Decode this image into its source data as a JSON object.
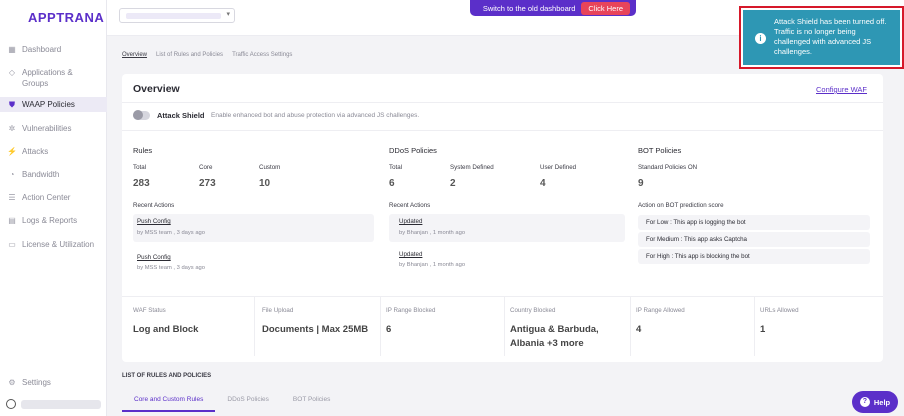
{
  "brand": {
    "logo": "APPTRANA",
    "accent": "#5b2fc9"
  },
  "sidebar": {
    "items": [
      {
        "label": "Dashboard",
        "icon": "grid-icon"
      },
      {
        "label": "Applications & Groups",
        "icon": "diamond-icon"
      },
      {
        "label": "WAAP Policies",
        "icon": "shield-icon",
        "active": true
      },
      {
        "label": "Vulnerabilities",
        "icon": "bug-icon"
      },
      {
        "label": "Attacks",
        "icon": "bolt-icon"
      },
      {
        "label": "Bandwidth",
        "icon": "gauge-icon"
      },
      {
        "label": "Action Center",
        "icon": "list-icon"
      },
      {
        "label": "Logs & Reports",
        "icon": "document-icon"
      },
      {
        "label": "License & Utilization",
        "icon": "card-icon"
      }
    ],
    "settings_label": "Settings"
  },
  "topbar": {
    "switch_text": "Switch to the old dashboard",
    "click_here": "Click Here"
  },
  "toast": {
    "message": "Attack Shield has been turned off. Traffic is no longer being challenged with advanced JS challenges.",
    "icon": "info-icon",
    "color": "#2e97b4",
    "border_color": "#d6182a"
  },
  "subtabs": [
    "Overview",
    "List of Rules and Policies",
    "Traffic Access Settings"
  ],
  "overview": {
    "title": "Overview",
    "configure_label": "Configure WAF",
    "attack_shield_label": "Attack Shield",
    "attack_shield_desc": "Enable enhanced bot and abuse protection via advanced JS challenges.",
    "attack_shield_enabled": false
  },
  "rules": {
    "title": "Rules",
    "total_label": "Total",
    "total": "283",
    "core_label": "Core",
    "core": "273",
    "custom_label": "Custom",
    "custom": "10",
    "recent_label": "Recent Actions",
    "actions": [
      {
        "title": "Push Config",
        "meta": "by MSS team , 3 days ago"
      },
      {
        "title": "Push Config",
        "meta": "by MSS team , 3 days ago"
      }
    ]
  },
  "ddos": {
    "title": "DDoS Policies",
    "total_label": "Total",
    "total": "6",
    "system_label": "System Defined",
    "system": "2",
    "user_label": "User Defined",
    "user": "4",
    "recent_label": "Recent Actions",
    "actions": [
      {
        "title": "Updated",
        "meta": "by Bhanjan , 1 month ago"
      },
      {
        "title": "Updated",
        "meta": "by Bhanjan , 1 month ago"
      }
    ]
  },
  "bot": {
    "title": "BOT Policies",
    "standard_label": "Standard Policies ON",
    "standard": "9",
    "prediction_label": "Action on BOT prediction score",
    "rows": [
      "For Low : This app is logging the bot",
      "For Medium : This app asks Captcha",
      "For High : This app is blocking the bot"
    ]
  },
  "status": [
    {
      "label": "WAF Status",
      "value": "Log and Block"
    },
    {
      "label": "File Upload",
      "value": "Documents | Max 25MB"
    },
    {
      "label": "IP Range Blocked",
      "value": "6"
    },
    {
      "label": "Country Blocked",
      "value": "Antigua & Barbuda, Albania +3 more"
    },
    {
      "label": "IP Range Allowed",
      "value": "4"
    },
    {
      "label": "URLs Allowed",
      "value": "1"
    }
  ],
  "list_section": {
    "title": "LIST OF RULES AND POLICIES",
    "tabs": [
      "Core and Custom Rules",
      "DDoS Policies",
      "BOT Policies"
    ]
  },
  "help_label": "Help"
}
